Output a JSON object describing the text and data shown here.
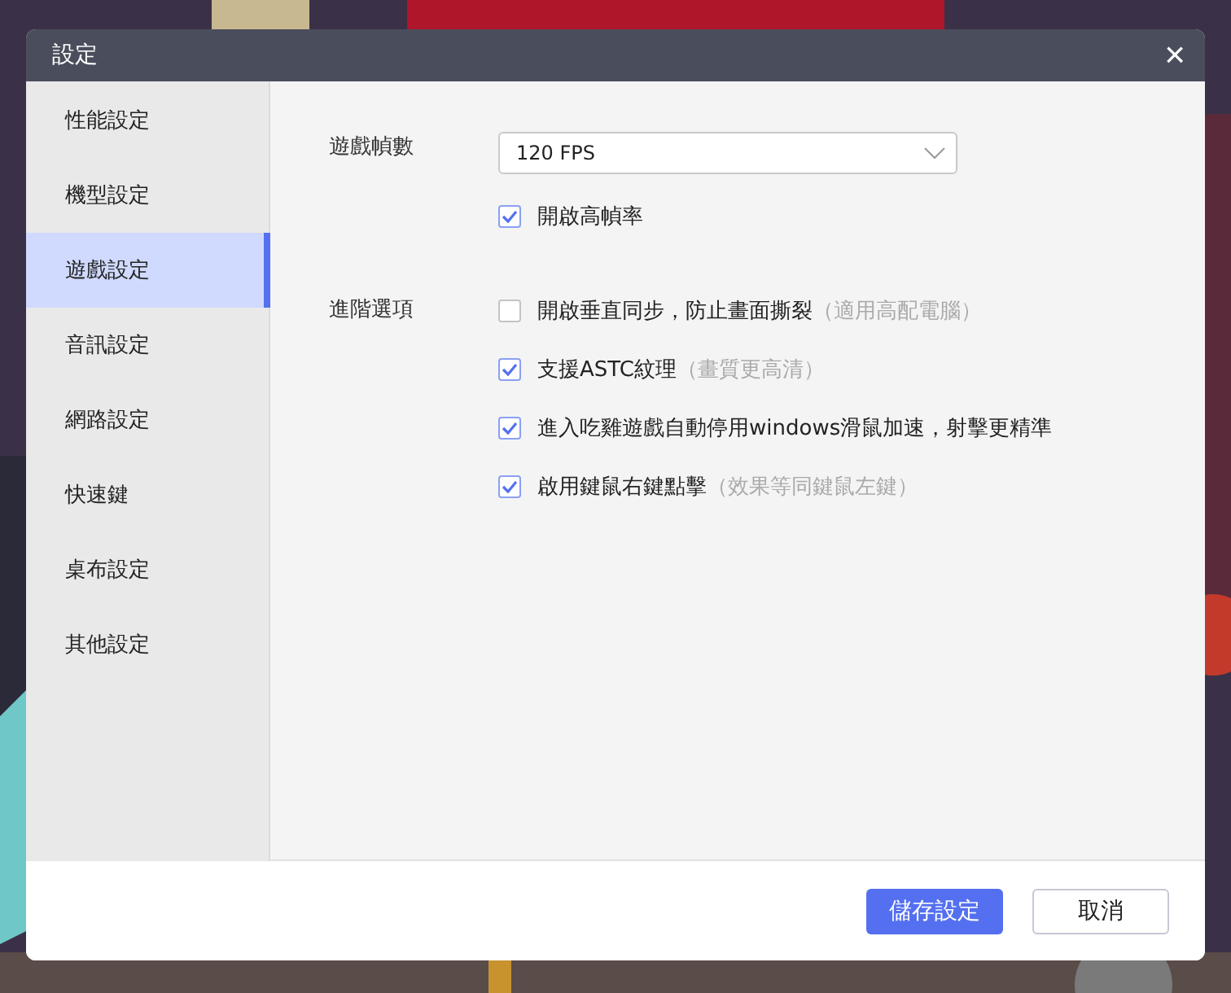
{
  "window": {
    "title": "設定",
    "close": "×"
  },
  "sidebar": {
    "items": [
      {
        "label": "性能設定",
        "selected": false
      },
      {
        "label": "機型設定",
        "selected": false
      },
      {
        "label": "遊戲設定",
        "selected": true
      },
      {
        "label": "音訊設定",
        "selected": false
      },
      {
        "label": "網路設定",
        "selected": false
      },
      {
        "label": "快速鍵",
        "selected": false
      },
      {
        "label": "桌布設定",
        "selected": false
      },
      {
        "label": "其他設定",
        "selected": false
      }
    ]
  },
  "frame_rate": {
    "label": "遊戲幀數",
    "value": "120 FPS",
    "high_fps": {
      "label": "開啟高幀率",
      "checked": true
    }
  },
  "advanced": {
    "label": "進階選項",
    "options": [
      {
        "label": "開啟垂直同步，防止畫面撕裂",
        "hint": "（適用高配電腦）",
        "checked": false
      },
      {
        "label": "支援ASTC紋理",
        "hint": "（畫質更高清）",
        "checked": true
      },
      {
        "label": "進入吃雞遊戲自動停用windows滑鼠加速，射擊更精準",
        "checked": true
      },
      {
        "label": "啟用鍵鼠右鍵點擊",
        "hint": "（效果等同鍵鼠左鍵）",
        "checked": true
      }
    ]
  },
  "buttons": {
    "save": "儲存設定",
    "cancel": "取消"
  }
}
